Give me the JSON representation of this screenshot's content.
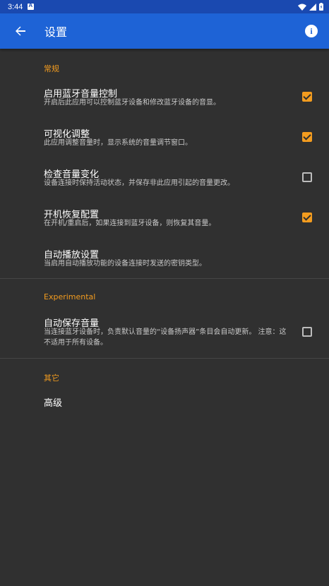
{
  "status_bar": {
    "time": "3:44"
  },
  "toolbar": {
    "title": "设置"
  },
  "sections": {
    "general": {
      "header": "常规",
      "items": [
        {
          "title": "启用蓝牙音量控制",
          "summary": "开启后此应用可以控制蓝牙设备和修改蓝牙设备的音显。",
          "checked": true
        },
        {
          "title": "可视化调整",
          "summary": "此应用调整音量时，显示系统的音量调节窗口。",
          "checked": true
        },
        {
          "title": "检查音量变化",
          "summary": "设备连接时保持活动状态，并保存非此应用引起的音量更改。",
          "checked": false
        },
        {
          "title": "开机恢复配置",
          "summary": "在开机/重启后，如果连接到蓝牙设备，则恢复其音量。",
          "checked": true
        },
        {
          "title": "自动播放设置",
          "summary": "当启用自动播放功能的设备连接时发送的密钥类型。"
        }
      ]
    },
    "experimental": {
      "header": "Experimental",
      "items": [
        {
          "title": "自动保存音量",
          "summary": "当连接蓝牙设备时，负责默认音量的“设备扬声器”条目会自动更新。 注意：这不适用于所有设备。",
          "checked": false
        }
      ]
    },
    "other": {
      "header": "其它",
      "items": [
        {
          "title": "高级"
        }
      ]
    }
  },
  "colors": {
    "accent": "#f39c1f",
    "toolbar": "#1e63d6",
    "status_bar": "#1a49b0",
    "background": "#303030"
  }
}
